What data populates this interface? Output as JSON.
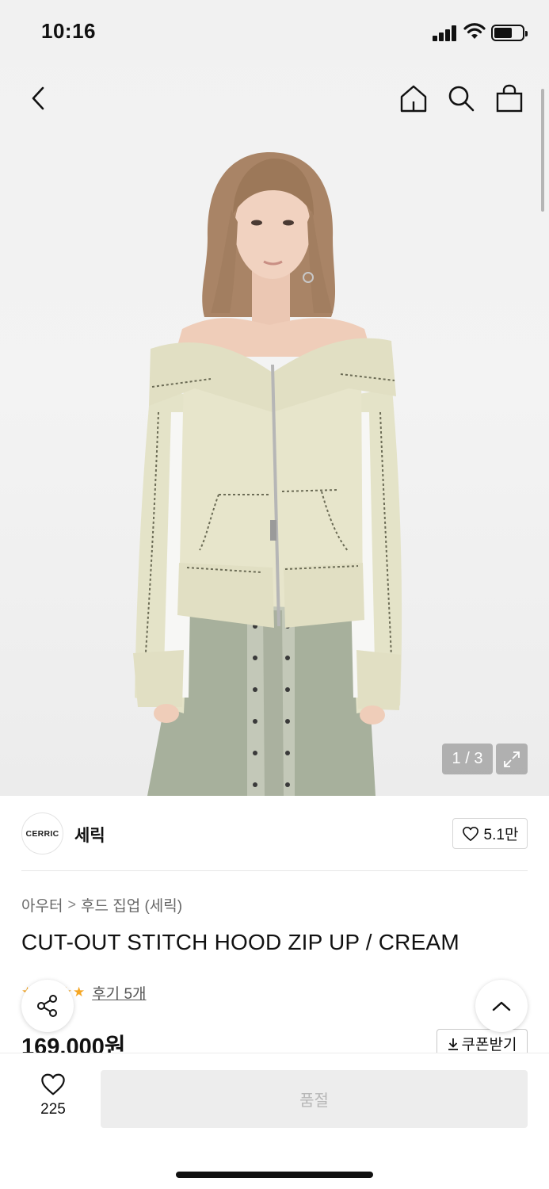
{
  "status_bar": {
    "time": "10:16"
  },
  "header": {
    "icons": [
      "chevron-left-icon",
      "home-icon",
      "search-icon",
      "shopping-bag-icon"
    ]
  },
  "gallery": {
    "counter": "1 / 3",
    "image_description_colors": {
      "jacket": "#e4e3c8",
      "skirt": "#a7b09c",
      "background": "#f1f1f1"
    }
  },
  "brand": {
    "logo_text": "CERRIC",
    "name": "세릭",
    "likes": "5.1만"
  },
  "breadcrumb": {
    "category": "아우터",
    "separator": ">",
    "subcategory": "후드 집업 (세릭)"
  },
  "product": {
    "title": "CUT-OUT STITCH HOOD ZIP UP / CREAM",
    "stars": "★★★★★",
    "review_link": "후기 5개",
    "price": "169,000원",
    "coupon_label": "쿠폰받기"
  },
  "bottom_bar": {
    "wish_count": "225",
    "purchase_label": "품절"
  },
  "colors": {
    "star": "#f5a623",
    "disabled_button_bg": "#ededed",
    "disabled_button_text": "#b7b7b7"
  }
}
